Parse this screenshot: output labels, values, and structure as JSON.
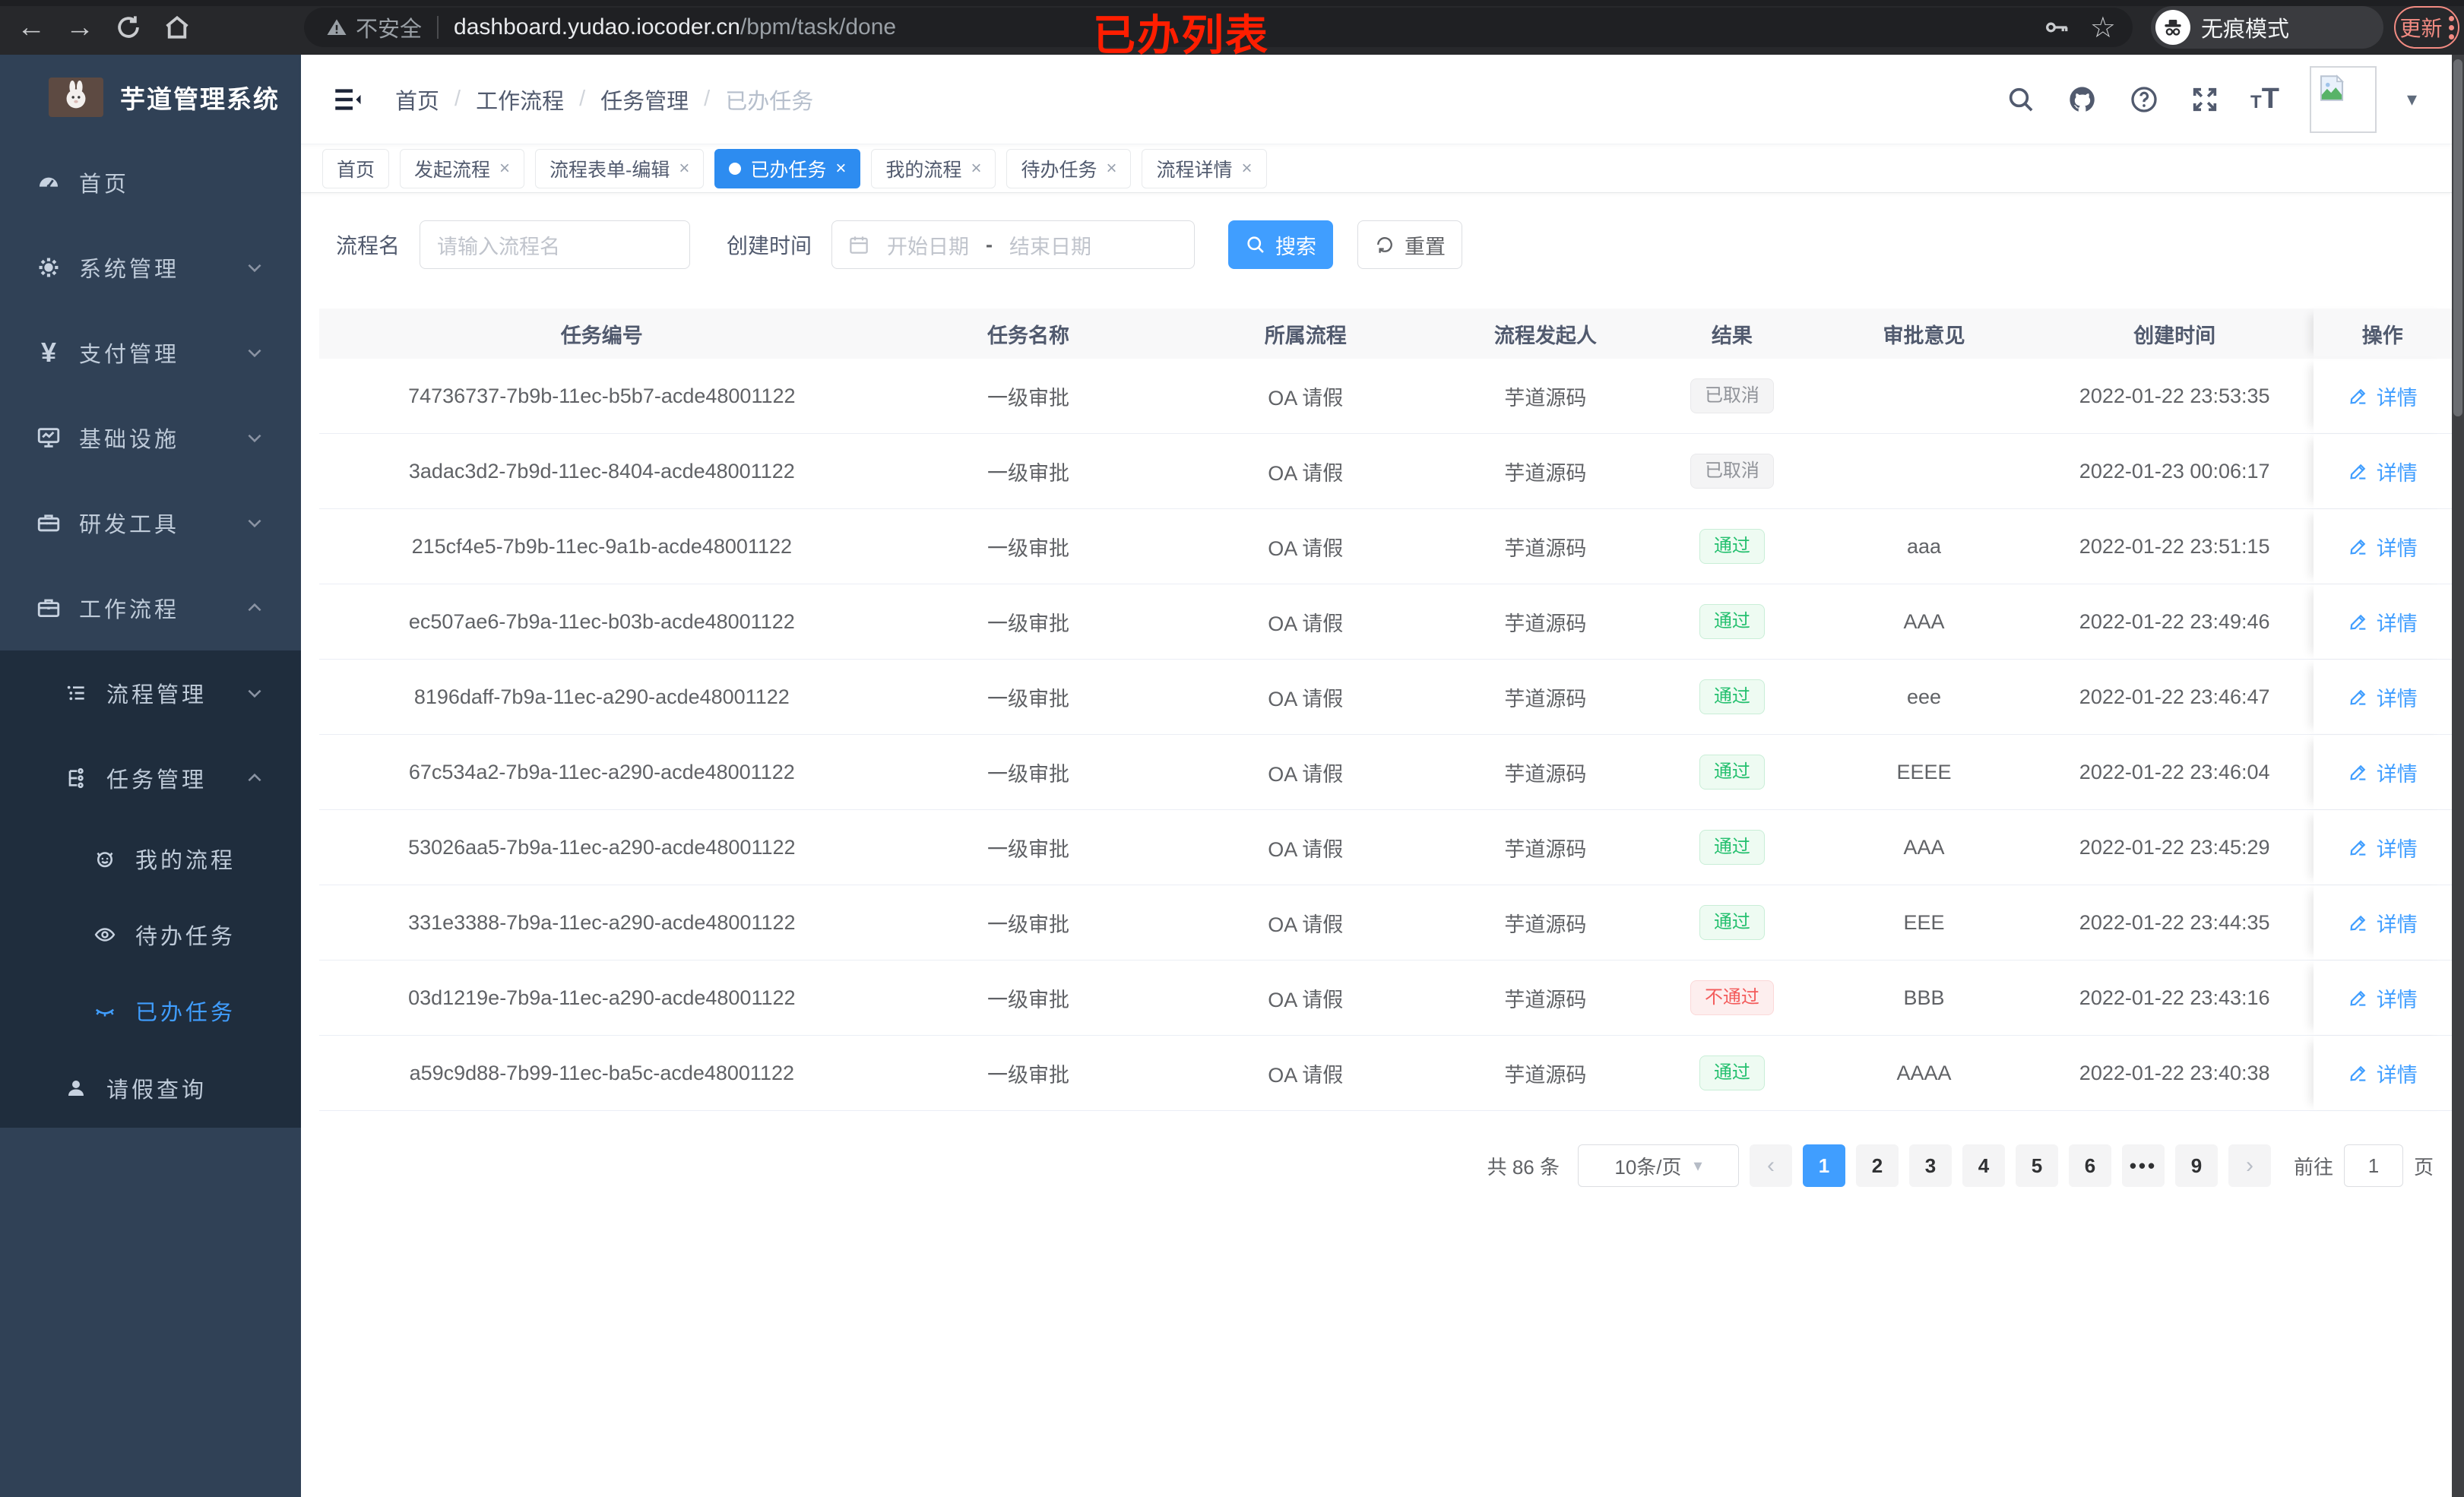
{
  "colors": {
    "accent": "#409eff",
    "tab_active": "#2d8cf0",
    "sidebar_bg": "#304156",
    "submenu_bg": "#1f2d3d",
    "success": "#25c06f",
    "danger": "#f35b5b",
    "info": "#909399",
    "annotation_red": "#ff1e00",
    "update_salmon": "#f28b82"
  },
  "icons": {
    "back": "←",
    "forward": "→",
    "star": "☆",
    "caret_down": "▾",
    "close": "×",
    "prev": "‹",
    "next": "›",
    "ellipsis": "•••",
    "yen": "¥",
    "slash": "/",
    "date_sep": "-",
    "small_t": "T",
    "big_t": "T"
  },
  "browser": {
    "security_warning": "不安全",
    "url_host": "dashboard.yudao.iocoder.cn",
    "url_path": "/bpm/task/done",
    "incognito_label": "无痕模式",
    "update_label": "更新"
  },
  "annotation": "已办列表",
  "sidebar": {
    "logo_title": "芋道管理系统",
    "items": [
      {
        "label": "首页"
      },
      {
        "label": "系统管理"
      },
      {
        "label": "支付管理"
      },
      {
        "label": "基础设施"
      },
      {
        "label": "研发工具"
      },
      {
        "label": "工作流程"
      }
    ],
    "workflow_submenu": {
      "process_mgmt": "流程管理",
      "task_mgmt": "任务管理",
      "my_process": "我的流程",
      "todo_tasks": "待办任务",
      "done_tasks": "已办任务",
      "leave_query": "请假查询"
    }
  },
  "header": {
    "breadcrumb": [
      "首页",
      "工作流程",
      "任务管理",
      "已办任务"
    ]
  },
  "tabs": [
    {
      "label": "首页"
    },
    {
      "label": "发起流程"
    },
    {
      "label": "流程表单-编辑"
    },
    {
      "label": "已办任务"
    },
    {
      "label": "我的流程"
    },
    {
      "label": "待办任务"
    },
    {
      "label": "流程详情"
    }
  ],
  "filters": {
    "process_name_label": "流程名",
    "process_name_placeholder": "请输入流程名",
    "create_time_label": "创建时间",
    "date_start_placeholder": "开始日期",
    "date_end_placeholder": "结束日期",
    "search_label": "搜索",
    "reset_label": "重置"
  },
  "table": {
    "columns": [
      "任务编号",
      "任务名称",
      "所属流程",
      "流程发起人",
      "结果",
      "审批意见",
      "创建时间",
      "操作"
    ],
    "detail_label": "详情",
    "rows": [
      {
        "id": "74736737-7b9b-11ec-b5b7-acde48001122",
        "name": "一级审批",
        "process": "OA 请假",
        "starter": "芋道源码",
        "result": "已取消",
        "result_type": "info",
        "opinion": "",
        "time": "2022-01-22 23:53:35",
        "action": "详情"
      },
      {
        "id": "3adac3d2-7b9d-11ec-8404-acde48001122",
        "name": "一级审批",
        "process": "OA 请假",
        "starter": "芋道源码",
        "result": "已取消",
        "result_type": "info",
        "opinion": "",
        "time": "2022-01-23 00:06:17",
        "action": "详情"
      },
      {
        "id": "215cf4e5-7b9b-11ec-9a1b-acde48001122",
        "name": "一级审批",
        "process": "OA 请假",
        "starter": "芋道源码",
        "result": "通过",
        "result_type": "success",
        "opinion": "aaa",
        "time": "2022-01-22 23:51:15",
        "action": "详情"
      },
      {
        "id": "ec507ae6-7b9a-11ec-b03b-acde48001122",
        "name": "一级审批",
        "process": "OA 请假",
        "starter": "芋道源码",
        "result": "通过",
        "result_type": "success",
        "opinion": "AAA",
        "time": "2022-01-22 23:49:46",
        "action": "详情"
      },
      {
        "id": "8196daff-7b9a-11ec-a290-acde48001122",
        "name": "一级审批",
        "process": "OA 请假",
        "starter": "芋道源码",
        "result": "通过",
        "result_type": "success",
        "opinion": "eee",
        "time": "2022-01-22 23:46:47",
        "action": "详情"
      },
      {
        "id": "67c534a2-7b9a-11ec-a290-acde48001122",
        "name": "一级审批",
        "process": "OA 请假",
        "starter": "芋道源码",
        "result": "通过",
        "result_type": "success",
        "opinion": "EEEE",
        "time": "2022-01-22 23:46:04",
        "action": "详情"
      },
      {
        "id": "53026aa5-7b9a-11ec-a290-acde48001122",
        "name": "一级审批",
        "process": "OA 请假",
        "starter": "芋道源码",
        "result": "通过",
        "result_type": "success",
        "opinion": "AAA",
        "time": "2022-01-22 23:45:29",
        "action": "详情"
      },
      {
        "id": "331e3388-7b9a-11ec-a290-acde48001122",
        "name": "一级审批",
        "process": "OA 请假",
        "starter": "芋道源码",
        "result": "通过",
        "result_type": "success",
        "opinion": "EEE",
        "time": "2022-01-22 23:44:35",
        "action": "详情"
      },
      {
        "id": "03d1219e-7b9a-11ec-a290-acde48001122",
        "name": "一级审批",
        "process": "OA 请假",
        "starter": "芋道源码",
        "result": "不通过",
        "result_type": "danger",
        "opinion": "BBB",
        "time": "2022-01-22 23:43:16",
        "action": "详情"
      },
      {
        "id": "a59c9d88-7b99-11ec-ba5c-acde48001122",
        "name": "一级审批",
        "process": "OA 请假",
        "starter": "芋道源码",
        "result": "通过",
        "result_type": "success",
        "opinion": "AAAA",
        "time": "2022-01-22 23:40:38",
        "action": "详情"
      }
    ]
  },
  "pagination": {
    "total_label": "共 86 条",
    "page_size": "10条/页",
    "pages": [
      "1",
      "2",
      "3",
      "4",
      "5",
      "6",
      "•••",
      "9"
    ],
    "active_page": "1",
    "goto_label": "前往",
    "goto_value": "1",
    "page_suffix": "页"
  }
}
